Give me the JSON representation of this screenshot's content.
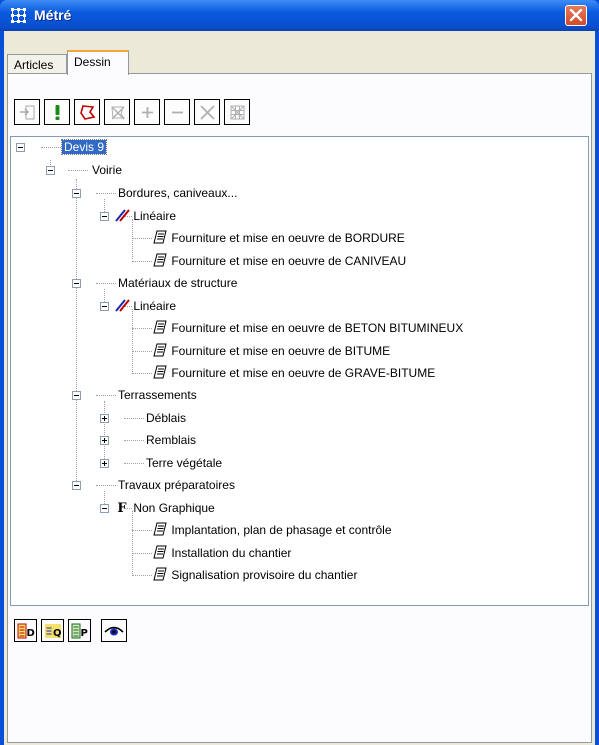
{
  "window": {
    "title": "Métré"
  },
  "tabs": [
    {
      "label": "Articles",
      "active": false
    },
    {
      "label": "Dessin",
      "active": true
    }
  ],
  "toolbar": {
    "buttons": [
      {
        "icon": "import-icon",
        "enabled": false
      },
      {
        "icon": "exclamation-icon",
        "enabled": true,
        "color": "#1a8a1a"
      },
      {
        "icon": "polygon-icon",
        "enabled": true,
        "color": "#c00000"
      },
      {
        "icon": "delete-polygon-icon",
        "enabled": false
      },
      {
        "icon": "plus-icon",
        "enabled": false
      },
      {
        "icon": "minus-icon",
        "enabled": false
      },
      {
        "icon": "cross-icon",
        "enabled": false
      },
      {
        "icon": "grid-icon",
        "enabled": false
      }
    ]
  },
  "tree": {
    "root": "Devis 9",
    "level1": "Voirie",
    "sections": {
      "bordures": "Bordures, caniveaux...",
      "bordures_lineaire": "Linéaire",
      "bordures_items": [
        "Fourniture et mise en oeuvre de BORDURE",
        "Fourniture et mise en oeuvre de CANIVEAU"
      ],
      "materiaux": "Matériaux de structure",
      "materiaux_lineaire": "Linéaire",
      "materiaux_items": [
        "Fourniture et mise en oeuvre de BETON BITUMINEUX",
        "Fourniture et mise en oeuvre de BITUME",
        "Fourniture et mise en oeuvre de GRAVE-BITUME"
      ],
      "terrassements": "Terrassements",
      "terrassements_items": [
        "Déblais",
        "Remblais",
        "Terre végétale"
      ],
      "travaux": "Travaux préparatoires",
      "non_graphique": "Non Graphique",
      "non_graphique_badge": "F",
      "travaux_items": [
        "Implantation, plan de phasage et contrôle",
        "Installation du chantier",
        "Signalisation provisoire du chantier"
      ]
    }
  },
  "bottom_buttons": [
    {
      "icon": "report-d-icon",
      "label": "D"
    },
    {
      "icon": "report-q-icon",
      "label": "Q"
    },
    {
      "icon": "report-p-icon",
      "label": "P"
    },
    {
      "icon": "eye-icon",
      "label": ""
    }
  ],
  "colors": {
    "titlebar": "#0a4fd8",
    "selection": "#316ac5",
    "close": "#d24a24",
    "face": "#ece9d8"
  }
}
